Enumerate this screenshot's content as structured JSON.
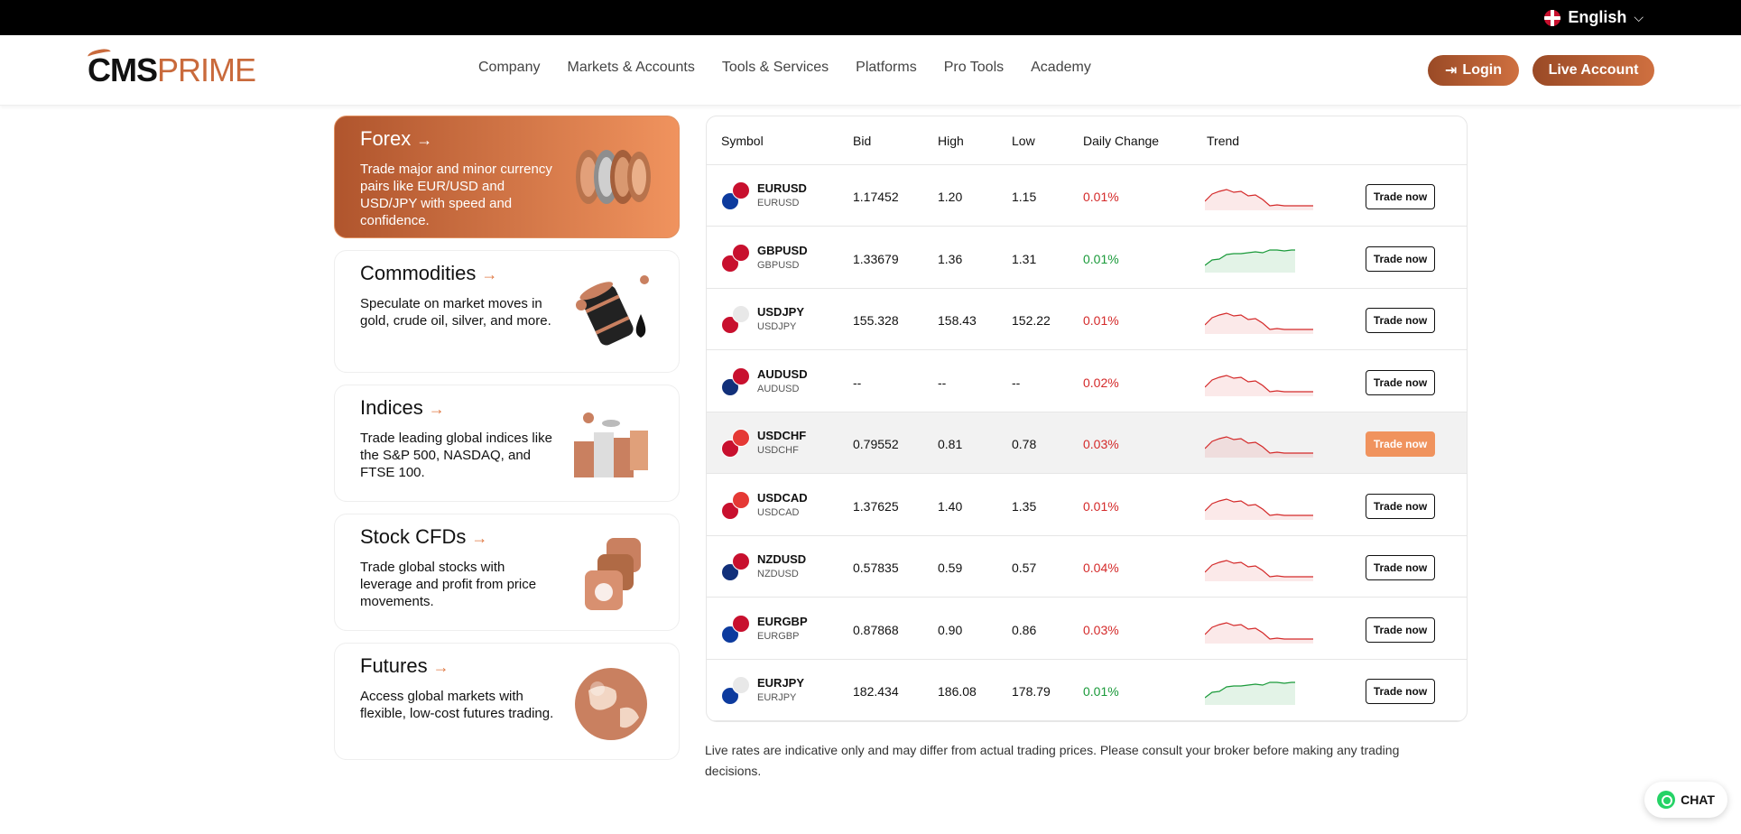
{
  "topbar": {
    "language": "English"
  },
  "brand": {
    "logo_main": "CMS",
    "logo_accent": "PRIME"
  },
  "nav": [
    "Company",
    "Markets & Accounts",
    "Tools & Services",
    "Platforms",
    "Pro Tools",
    "Academy"
  ],
  "actions": {
    "login": "Login",
    "live_account": "Live Account"
  },
  "cards": [
    {
      "title": "Forex",
      "desc": "Trade major and minor currency pairs like EUR/USD and USD/JPY with speed and confidence.",
      "active": true,
      "icon": "coins-icon"
    },
    {
      "title": "Commodities",
      "desc": "Speculate on market moves in gold, crude oil, silver, and more.",
      "active": false,
      "icon": "oil-barrel-icon"
    },
    {
      "title": "Indices",
      "desc": "Trade leading global indices like the S&P 500, NASDAQ, and FTSE 100.",
      "active": false,
      "icon": "stacked-coins-icon"
    },
    {
      "title": "Stock CFDs",
      "desc": "Trade global stocks with leverage and profit from price movements.",
      "active": false,
      "icon": "stock-logos-icon"
    },
    {
      "title": "Futures",
      "desc": "Access global markets with flexible, low-cost futures trading.",
      "active": false,
      "icon": "globe-icon"
    }
  ],
  "table": {
    "headers": [
      "Symbol",
      "Bid",
      "High",
      "Low",
      "Daily Change",
      "Trend"
    ],
    "trade_label": "Trade now",
    "rows": [
      {
        "symbol": "EURUSD",
        "sub": "EURUSD",
        "bid": "1.17452",
        "high": "1.20",
        "low": "1.15",
        "change": "0.01%",
        "dir": "neg",
        "flags": [
          "#0d3b9e",
          "#c8102e"
        ]
      },
      {
        "symbol": "GBPUSD",
        "sub": "GBPUSD",
        "bid": "1.33679",
        "high": "1.36",
        "low": "1.31",
        "change": "0.01%",
        "dir": "pos",
        "flags": [
          "#c8102e",
          "#c8102e"
        ]
      },
      {
        "symbol": "USDJPY",
        "sub": "USDJPY",
        "bid": "155.328",
        "high": "158.43",
        "low": "152.22",
        "change": "0.01%",
        "dir": "neg",
        "flags": [
          "#c8102e",
          "#e8e8e8"
        ]
      },
      {
        "symbol": "AUDUSD",
        "sub": "AUDUSD",
        "bid": "--",
        "high": "--",
        "low": "--",
        "change": "0.02%",
        "dir": "neg",
        "flags": [
          "#12307a",
          "#c8102e"
        ]
      },
      {
        "symbol": "USDCHF",
        "sub": "USDCHF",
        "bid": "0.79552",
        "high": "0.81",
        "low": "0.78",
        "change": "0.03%",
        "dir": "neg",
        "flags": [
          "#c8102e",
          "#e53935"
        ]
      },
      {
        "symbol": "USDCAD",
        "sub": "USDCAD",
        "bid": "1.37625",
        "high": "1.40",
        "low": "1.35",
        "change": "0.01%",
        "dir": "neg",
        "flags": [
          "#c8102e",
          "#e53935"
        ]
      },
      {
        "symbol": "NZDUSD",
        "sub": "NZDUSD",
        "bid": "0.57835",
        "high": "0.59",
        "low": "0.57",
        "change": "0.04%",
        "dir": "neg",
        "flags": [
          "#12307a",
          "#c8102e"
        ]
      },
      {
        "symbol": "EURGBP",
        "sub": "EURGBP",
        "bid": "0.87868",
        "high": "0.90",
        "low": "0.86",
        "change": "0.03%",
        "dir": "neg",
        "flags": [
          "#0d3b9e",
          "#c8102e"
        ]
      },
      {
        "symbol": "EURJPY",
        "sub": "EURJPY",
        "bid": "182.434",
        "high": "186.08",
        "low": "178.79",
        "change": "0.01%",
        "dir": "pos",
        "flags": [
          "#0d3b9e",
          "#e8e8e8"
        ]
      }
    ]
  },
  "disclaimer": "Live rates are indicative only and may differ from actual trading prices. Please consult your broker before making any trading decisions.",
  "chat_label": "CHAT",
  "colors": {
    "accent": "#c96a3c",
    "negative": "#d42a2a",
    "positive": "#1a9a3a"
  }
}
